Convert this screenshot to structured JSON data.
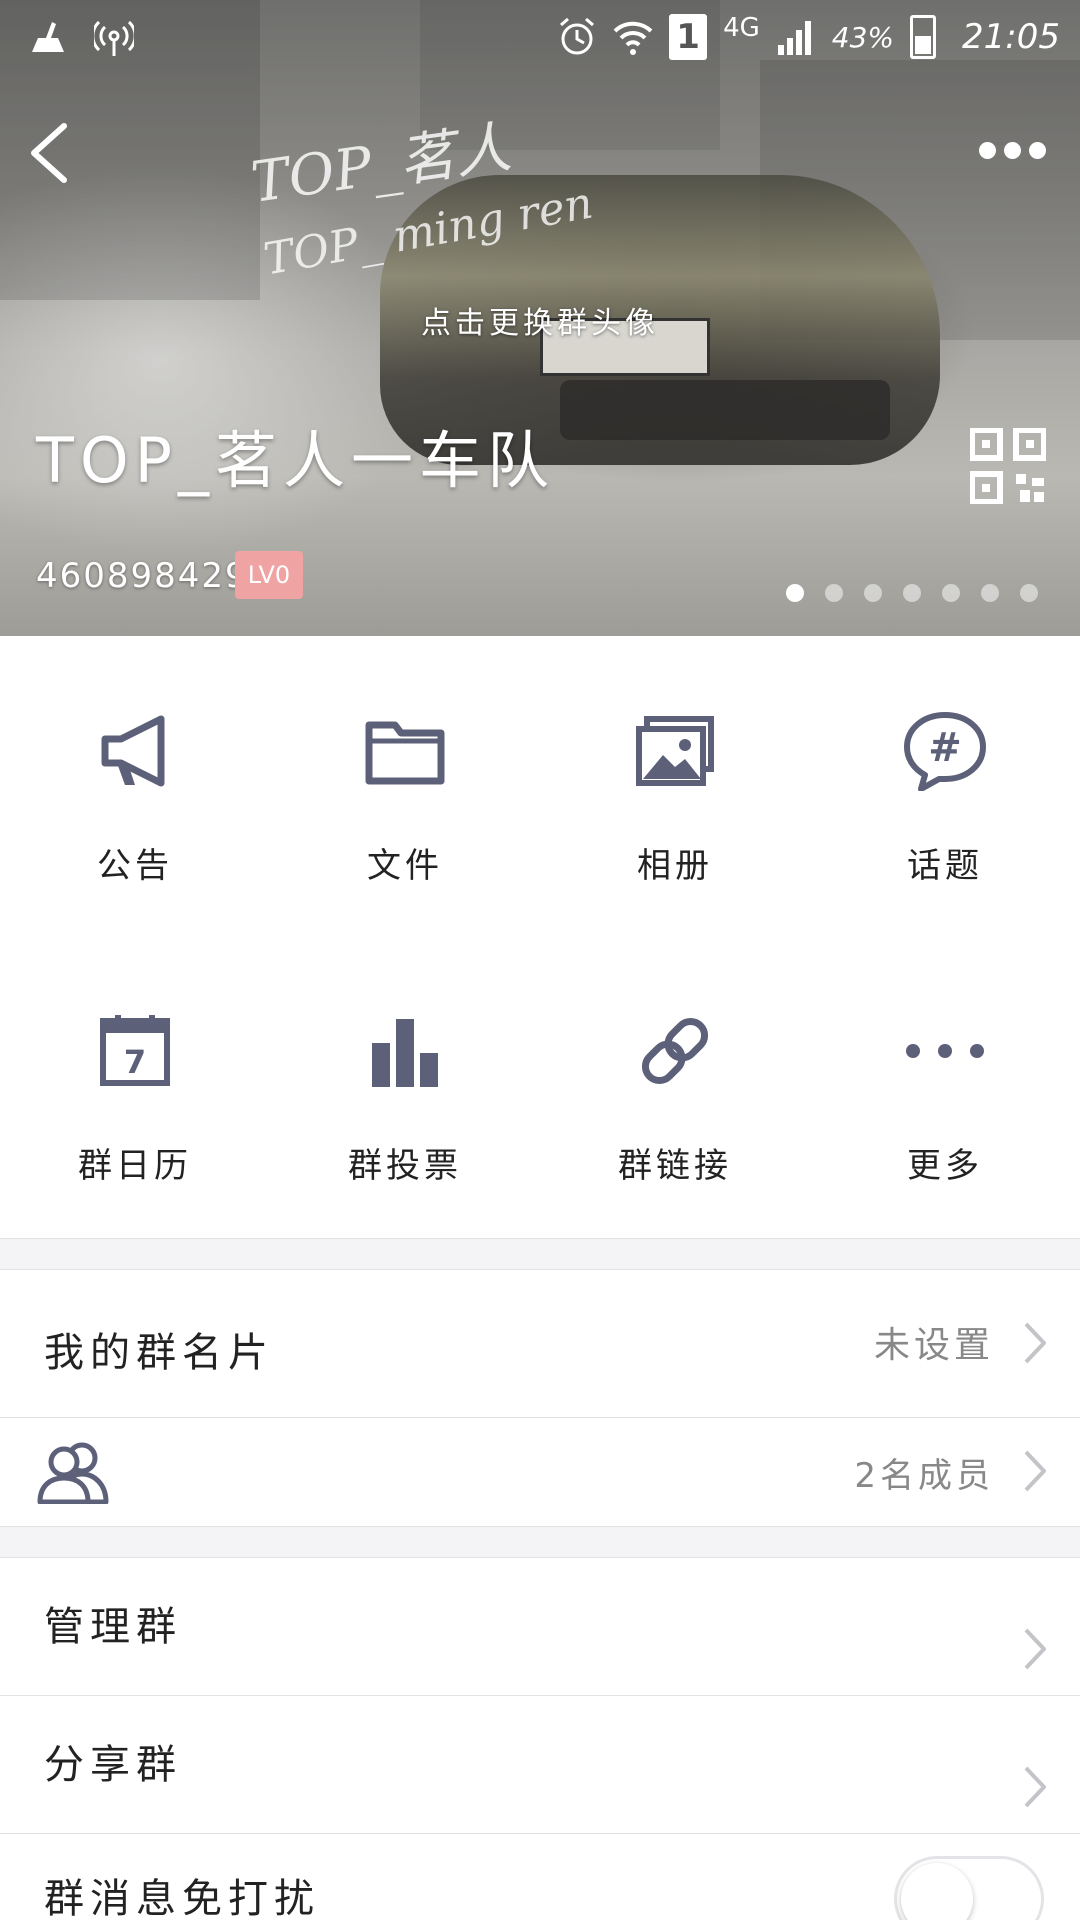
{
  "status_bar": {
    "network": "4G",
    "sim_slot": "1",
    "battery": "43%",
    "time": "21:05"
  },
  "header": {
    "watermark_line1": "TOP_茗人",
    "watermark_line2": "TOP_ ming ren",
    "change_avatar_hint": "点击更换群头像",
    "group_name": "TOP_茗人一车队",
    "group_id": "460898429",
    "level": "LV0",
    "carousel_pages": 7,
    "carousel_active_index": 0
  },
  "features": [
    {
      "label": "公告",
      "icon": "megaphone-icon"
    },
    {
      "label": "文件",
      "icon": "folder-icon"
    },
    {
      "label": "相册",
      "icon": "album-icon"
    },
    {
      "label": "话题",
      "icon": "topic-hash-icon"
    },
    {
      "label": "群日历",
      "icon": "calendar-icon"
    },
    {
      "label": "群投票",
      "icon": "bar-chart-icon"
    },
    {
      "label": "群链接",
      "icon": "link-icon"
    },
    {
      "label": "更多",
      "icon": "more-dots-icon"
    }
  ],
  "list": {
    "card": {
      "title": "我的群名片",
      "value": "未设置"
    },
    "members": {
      "value": "2名成员"
    },
    "manage": {
      "title": "管理群"
    },
    "share": {
      "title": "分享群"
    },
    "mute": {
      "title": "群消息免打扰",
      "enabled": false
    }
  },
  "colors": {
    "icon": "#5d6079",
    "badge": "#f0a3a3",
    "divider": "#e3e3e6",
    "section_gap": "#f4f4f6"
  }
}
